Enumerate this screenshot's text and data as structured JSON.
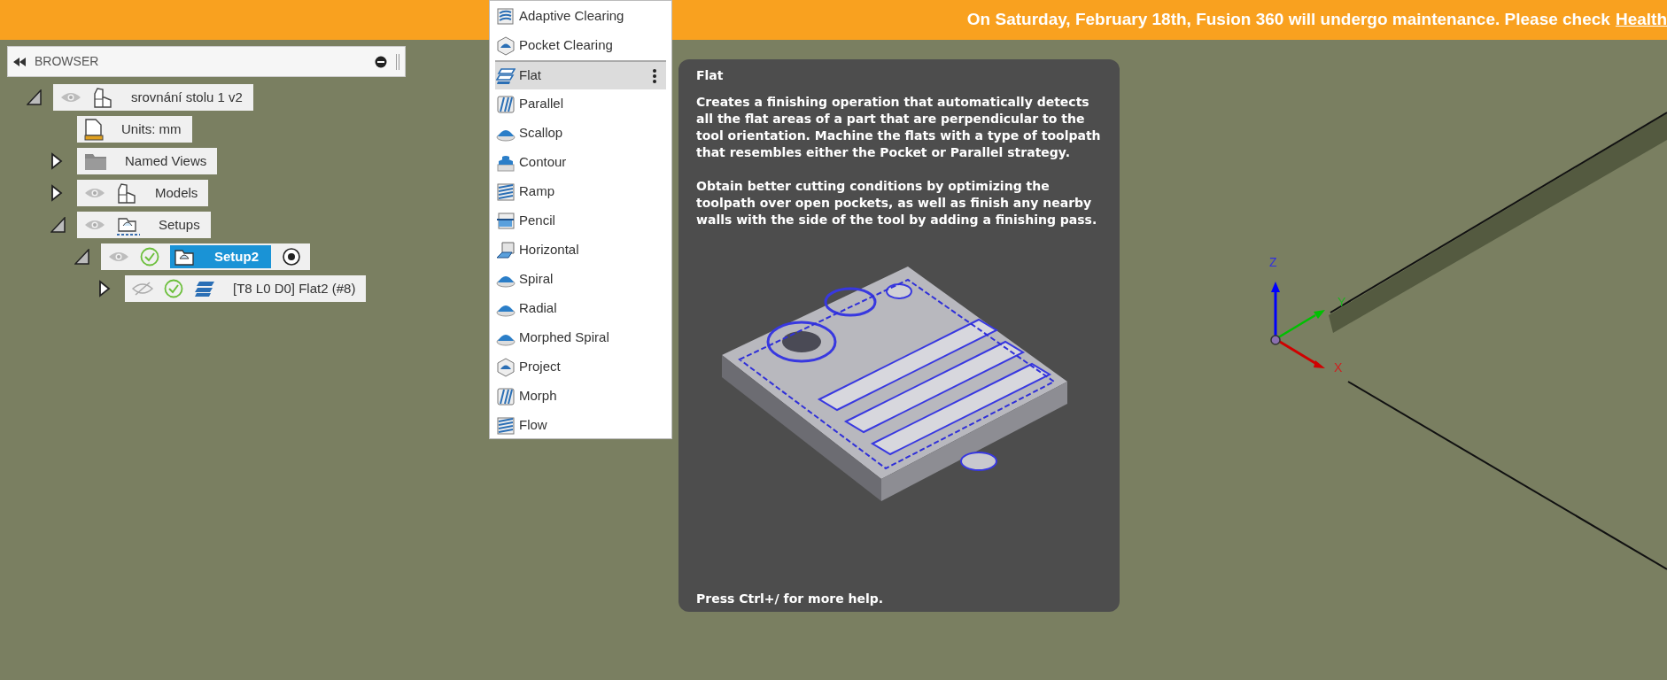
{
  "banner": {
    "text": "On Saturday, February 18th, Fusion 360 will undergo maintenance. Please check",
    "link": "Health"
  },
  "browser": {
    "title": "BROWSER",
    "items": [
      {
        "label": "srovnání stolu 1 v2",
        "kind": "component",
        "expanded": true,
        "visible": true,
        "selected": false,
        "children": [
          {
            "label": "Units: mm",
            "kind": "units",
            "selected": false
          },
          {
            "label": "Named Views",
            "kind": "folder",
            "expanded": false,
            "selected": false
          },
          {
            "label": "Models",
            "kind": "component",
            "expanded": false,
            "visible": true,
            "selected": false
          },
          {
            "label": "Setups",
            "kind": "setups",
            "expanded": true,
            "visible": true,
            "selected": false,
            "children": [
              {
                "label": "Setup2",
                "kind": "setup",
                "expanded": true,
                "visible": true,
                "checked": true,
                "active": true,
                "selected": true,
                "children": [
                  {
                    "label": "[T8 L0 D0] Flat2 (#8)",
                    "kind": "operation",
                    "expanded": false,
                    "visible": false,
                    "checked": true,
                    "active": false,
                    "selected": false
                  }
                ]
              }
            ]
          }
        ]
      }
    ]
  },
  "menu": {
    "items": [
      {
        "label": "Adaptive Clearing",
        "selected": false
      },
      {
        "label": "Pocket Clearing",
        "selected": false
      },
      {
        "label": "Flat",
        "selected": true
      },
      {
        "label": "Parallel",
        "selected": false
      },
      {
        "label": "Scallop",
        "selected": false
      },
      {
        "label": "Contour",
        "selected": false
      },
      {
        "label": "Ramp",
        "selected": false
      },
      {
        "label": "Pencil",
        "selected": false
      },
      {
        "label": "Horizontal",
        "selected": false
      },
      {
        "label": "Spiral",
        "selected": false
      },
      {
        "label": "Radial",
        "selected": false
      },
      {
        "label": "Morphed Spiral",
        "selected": false
      },
      {
        "label": "Project",
        "selected": false
      },
      {
        "label": "Morph",
        "selected": false
      },
      {
        "label": "Flow",
        "selected": false
      }
    ]
  },
  "tooltip": {
    "title": "Flat",
    "paragraphs": [
      "Creates a finishing operation that automatically detects all the flat areas of a part that are perpendicular to the tool orientation. Machine the flats with a type of toolpath that resembles either the Pocket or Parallel strategy.",
      "Obtain better cutting conditions by optimizing the toolpath over open pockets, as well as finish any nearby walls with the side of the tool by adding a finishing pass."
    ],
    "footer": "Press Ctrl+/ for more help."
  },
  "viewport": {
    "triad": {
      "z": "Z",
      "y": "Y",
      "x": "X"
    }
  }
}
